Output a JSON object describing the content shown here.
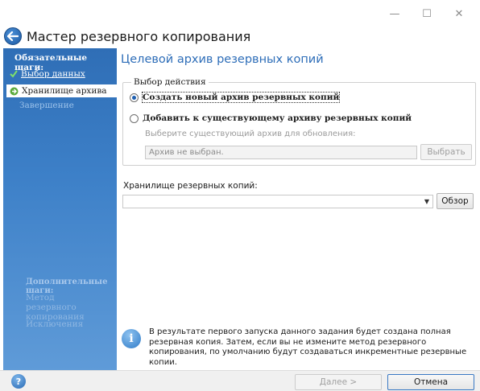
{
  "window": {
    "title": "Мастер резервного копирования",
    "minimize_glyph": "—",
    "maximize_glyph": "☐",
    "close_glyph": "✕"
  },
  "sidebar": {
    "required_heading": "Обязательные шаги:",
    "steps": [
      {
        "label": "Выбор данных",
        "state": "done"
      },
      {
        "label": "Хранилище архива",
        "state": "current"
      },
      {
        "label": "Завершение",
        "state": "pending"
      }
    ],
    "optional_heading": "Дополнительные шаги:",
    "optional_steps": [
      {
        "label": "Метод резервного копирования"
      },
      {
        "label": "Исключения"
      }
    ]
  },
  "main": {
    "title": "Целевой архив резервных копий",
    "action_group": {
      "legend": "Выбор действия",
      "option_new": "Создать новый архив резервных копий",
      "option_existing": "Добавить к существующему архиву резервных копий",
      "selected": "new",
      "hint": "Выберите существующий архив для обновления:",
      "archive_field_value": "Архив не выбран.",
      "select_button": "Выбрать"
    },
    "storage": {
      "label": "Хранилище резервных копий:",
      "value": "",
      "browse_button": "Обзор"
    },
    "info": {
      "text": "В результате первого запуска данного задания будет создана полная резервная копия. Затем, если вы не измените метод резервного копирования, по умолчанию будут создаваться инкрементные резервные копии."
    }
  },
  "footer": {
    "next_button": "Далее >",
    "cancel_button": "Отмена"
  },
  "colors": {
    "accent": "#2d6db8",
    "sidebar_top": "#2f6eb6",
    "sidebar_bottom": "#5f9bd8"
  }
}
